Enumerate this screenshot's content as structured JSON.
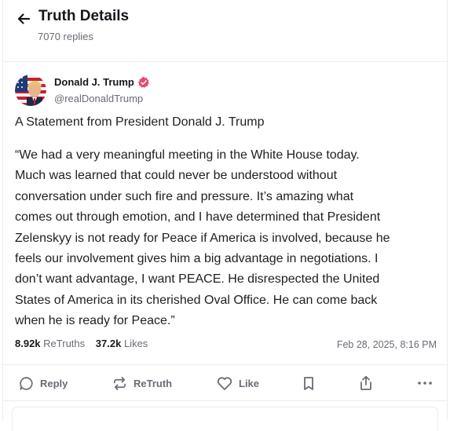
{
  "header": {
    "title": "Truth Details",
    "reply_count": "7070 replies"
  },
  "author": {
    "display_name": "Donald J. Trump",
    "handle": "@realDonaldTrump",
    "verified_color": "#e94b6a"
  },
  "post": {
    "title": "A Statement from President Donald J. Trump",
    "lines": [
      "“We had a very meaningful meeting in the White House today.",
      "Much was learned that could never be understood without",
      "conversation under such fire and pressure. It’s amazing what",
      "comes out through emotion, and I have determined that President",
      "Zelenskyy is not ready for Peace if America is involved, because he",
      "feels our involvement gives him a big advantage in negotiations. I",
      "don’t want advantage, I want PEACE. He disrespected the United",
      "States of America in its cherished Oval Office. He can come back",
      "when he is ready for Peace.”"
    ]
  },
  "stats": {
    "retruths_count": "8.92k",
    "retruths_label": "ReTruths",
    "likes_count": "37.2k",
    "likes_label": "Likes",
    "timestamp": "Feb 28, 2025, 8:16 PM"
  },
  "actions": {
    "reply_label": "Reply",
    "retruth_label": "ReTruth",
    "like_label": "Like"
  },
  "icons": [
    "back-arrow-icon",
    "verified-icon",
    "reply-icon",
    "retruth-icon",
    "heart-icon",
    "bookmark-icon",
    "share-icon",
    "more-icon"
  ]
}
